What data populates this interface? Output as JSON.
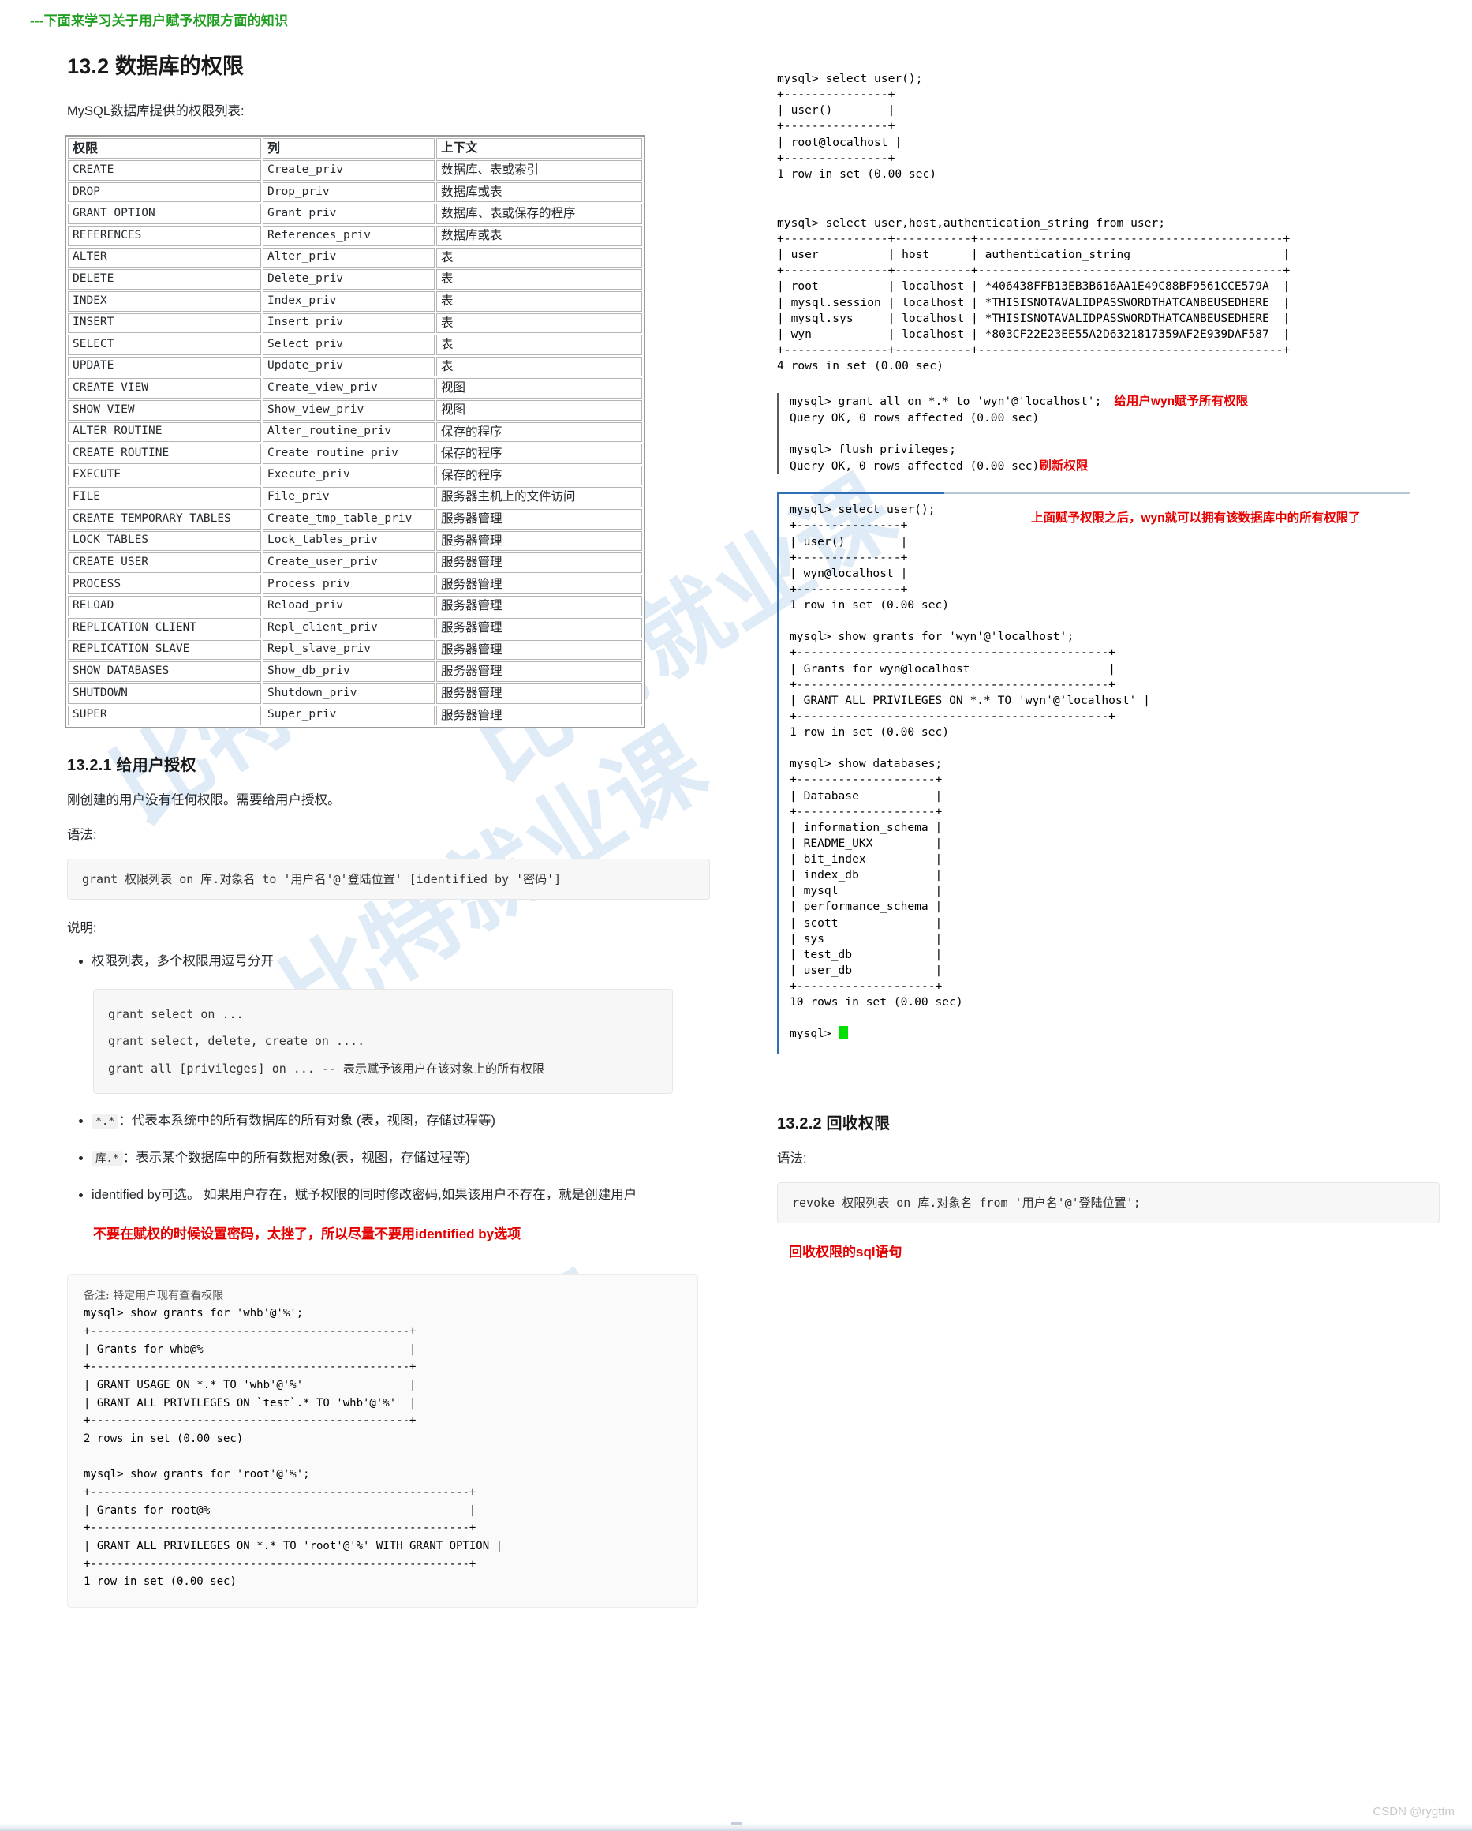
{
  "top_note": "---下面来学习关于用户赋予权限方面的知识",
  "left": {
    "section_title": "13.2 数据库的权限",
    "intro": "MySQL数据库提供的权限列表:",
    "priv_table": {
      "headers": [
        "权限",
        "列",
        "上下文"
      ],
      "rows": [
        [
          "CREATE",
          "Create_priv",
          "数据库、表或索引"
        ],
        [
          "DROP",
          "Drop_priv",
          "数据库或表"
        ],
        [
          "GRANT OPTION",
          "Grant_priv",
          "数据库、表或保存的程序"
        ],
        [
          "REFERENCES",
          "References_priv",
          "数据库或表"
        ],
        [
          "ALTER",
          "Alter_priv",
          "表"
        ],
        [
          "DELETE",
          "Delete_priv",
          "表"
        ],
        [
          "INDEX",
          "Index_priv",
          "表"
        ],
        [
          "INSERT",
          "Insert_priv",
          "表"
        ],
        [
          "SELECT",
          "Select_priv",
          "表"
        ],
        [
          "UPDATE",
          "Update_priv",
          "表"
        ],
        [
          "CREATE VIEW",
          "Create_view_priv",
          "视图"
        ],
        [
          "SHOW VIEW",
          "Show_view_priv",
          "视图"
        ],
        [
          "ALTER ROUTINE",
          "Alter_routine_priv",
          "保存的程序"
        ],
        [
          "CREATE ROUTINE",
          "Create_routine_priv",
          "保存的程序"
        ],
        [
          "EXECUTE",
          "Execute_priv",
          "保存的程序"
        ],
        [
          "FILE",
          "File_priv",
          "服务器主机上的文件访问"
        ],
        [
          "CREATE TEMPORARY TABLES",
          "Create_tmp_table_priv",
          "服务器管理"
        ],
        [
          "LOCK TABLES",
          "Lock_tables_priv",
          "服务器管理"
        ],
        [
          "CREATE USER",
          "Create_user_priv",
          "服务器管理"
        ],
        [
          "PROCESS",
          "Process_priv",
          "服务器管理"
        ],
        [
          "RELOAD",
          "Reload_priv",
          "服务器管理"
        ],
        [
          "REPLICATION CLIENT",
          "Repl_client_priv",
          "服务器管理"
        ],
        [
          "REPLICATION SLAVE",
          "Repl_slave_priv",
          "服务器管理"
        ],
        [
          "SHOW DATABASES",
          "Show_db_priv",
          "服务器管理"
        ],
        [
          "SHUTDOWN",
          "Shutdown_priv",
          "服务器管理"
        ],
        [
          "SUPER",
          "Super_priv",
          "服务器管理"
        ]
      ]
    },
    "sub1_title": "13.2.1 给用户授权",
    "sub1_para": "刚创建的用户没有任何权限。需要给用户授权。",
    "syntax_label": "语法:",
    "grant_syntax": "grant 权限列表 on 库.对象名 to '用户名'@'登陆位置' [identified by '密码']",
    "note_label": "说明:",
    "bullet1": "权限列表，多个权限用逗号分开",
    "grant_examples": [
      "grant select on ...",
      "grant select, delete, create on ....",
      "grant all [privileges] on ... -- 表示赋予该用户在该对象上的所有权限"
    ],
    "bullet2_code": "*.*",
    "bullet2_text": "：代表本系统中的所有数据库的所有对象 (表，视图，存储过程等)",
    "bullet3_code": "库.*",
    "bullet3_text": "：表示某个数据库中的所有数据对象(表，视图，存储过程等)",
    "bullet4": "identified by可选。 如果用户存在，赋予权限的同时修改密码,如果该用户不存在，就是创建用户",
    "warning": "不要在赋权的时候设置密码，太挫了，所以尽量不要用identified by选项",
    "terminal_note": "备注: 特定用户现有查看权限",
    "terminal_lines": [
      "mysql> show grants for 'whb'@'%';",
      "+------------------------------------------------+",
      "| Grants for whb@%                               |",
      "+------------------------------------------------+",
      "| GRANT USAGE ON *.* TO 'whb'@'%'                |",
      "| GRANT ALL PRIVILEGES ON `test`.* TO 'whb'@'%'  |",
      "+------------------------------------------------+",
      "2 rows in set (0.00 sec)",
      "",
      "mysql> show grants for 'root'@'%';",
      "+---------------------------------------------------------+",
      "| Grants for root@%                                       |",
      "+---------------------------------------------------------+",
      "| GRANT ALL PRIVILEGES ON *.* TO 'root'@'%' WITH GRANT OPTION |",
      "+---------------------------------------------------------+",
      "1 row in set (0.00 sec)"
    ]
  },
  "right": {
    "term1": [
      "mysql> select user();",
      "+---------------+",
      "| user()        |",
      "+---------------+",
      "| root@localhost |",
      "+---------------+",
      "1 row in set (0.00 sec)"
    ],
    "term2": [
      "mysql> select user,host,authentication_string from user;",
      "+---------------+-----------+--------------------------------------------+",
      "| user          | host      | authentication_string                      |",
      "+---------------+-----------+--------------------------------------------+",
      "| root          | localhost | *406438FFB13EB3B616AA1E49C88BF9561CCE579A  |",
      "| mysql.session | localhost | *THISISNOTAVALIDPASSWORDTHATCANBEUSEDHERE  |",
      "| mysql.sys     | localhost | *THISISNOTAVALIDPASSWORDTHATCANBEUSEDHERE  |",
      "| wyn           | localhost | *803CF22E23EE55A2D6321817359AF2E939DAF587  |",
      "+---------------+-----------+--------------------------------------------+",
      "4 rows in set (0.00 sec)"
    ],
    "term3_line1": "mysql> grant all on *.* to 'wyn'@'localhost';",
    "term3_annot1": "给用户wyn赋予所有权限",
    "term3_line2": "Query OK, 0 rows affected (0.00 sec)",
    "term3_line3": "mysql> flush privileges;",
    "term3_line4": "Query OK, 0 rows affected (0.00 sec)",
    "term3_annot2": "刷新权限",
    "panel_annot": "上面赋予权限之后，wyn就可以拥有该数据库中的所有权限了",
    "panel_lines_a": [
      "mysql> select user();",
      "+---------------+",
      "| user()        |",
      "+---------------+",
      "| wyn@localhost |",
      "+---------------+",
      "1 row in set (0.00 sec)"
    ],
    "panel_lines_b": [
      "mysql> show grants for 'wyn'@'localhost';",
      "+---------------------------------------------+",
      "| Grants for wyn@localhost                    |",
      "+---------------------------------------------+",
      "| GRANT ALL PRIVILEGES ON *.* TO 'wyn'@'localhost' |",
      "+---------------------------------------------+",
      "1 row in set (0.00 sec)"
    ],
    "panel_lines_c": [
      "mysql> show databases;",
      "+--------------------+",
      "| Database           |",
      "+--------------------+",
      "| information_schema |",
      "| README_UKX         |",
      "| bit_index          |",
      "| index_db           |",
      "| mysql              |",
      "| performance_schema |",
      "| scott              |",
      "| sys                |",
      "| test_db            |",
      "| user_db            |",
      "+--------------------+",
      "10 rows in set (0.00 sec)"
    ],
    "panel_prompt": "mysql> ",
    "sub2_title": "13.2.2 回收权限",
    "syntax_label": "语法:",
    "revoke_syntax": "revoke 权限列表 on 库.对象名 from '用户名'@'登陆位置';",
    "revoke_note": "回收权限的sql语句"
  },
  "watermark_text": "比特就业课",
  "footer_credit": "CSDN @rygttm",
  "colors": {
    "green_note": "#20a020",
    "red_annot": "#e60000",
    "blue_panel": "#2f6fb5",
    "cursor_green": "#00e000"
  }
}
